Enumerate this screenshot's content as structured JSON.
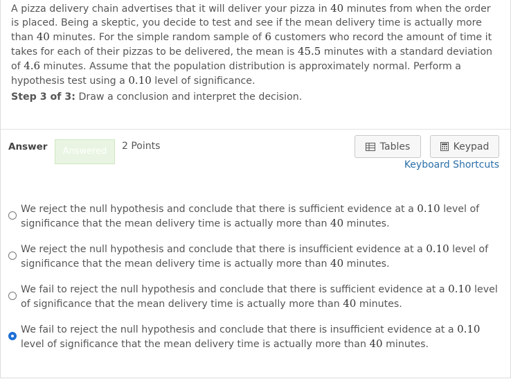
{
  "question": {
    "p1": "A pizza delivery chain advertises that it will deliver your pizza in ",
    "n1": "40",
    "p2": " minutes from when the order is placed. Being a skeptic, you decide to test and see if the mean delivery time is actually more than ",
    "n2": "40",
    "p3": " minutes. For the simple random sample of ",
    "n3": "6",
    "p4": " customers who record the amount of time it takes for each of their pizzas to be delivered, the mean is ",
    "n4": "45.5",
    "p5": " minutes with a standard deviation of ",
    "n5": "4.6",
    "p6": " minutes. Assume that the population distribution is approximately normal. Perform a hypothesis test using a ",
    "n6": "0.10",
    "p7": " level of significance."
  },
  "step": {
    "label": "Step 3 of 3:",
    "text": " Draw a conclusion and interpret the decision."
  },
  "answer": {
    "label": "Answer",
    "status": "Answered",
    "points": "2 Points"
  },
  "tools": {
    "tables_label": "Tables",
    "keypad_label": "Keypad",
    "shortcuts_label": "Keyboard Shortcuts"
  },
  "options": [
    {
      "a": "We reject the null hypothesis and conclude that there is sufficient evidence at a ",
      "n1": "0.10",
      "b": " level of significance that the mean delivery time is actually more than ",
      "n2": "40",
      "c": " minutes.",
      "selected": false
    },
    {
      "a": "We reject the null hypothesis and conclude that there is insufficient evidence at a ",
      "n1": "0.10",
      "b": " level of significance that the mean delivery time is actually more than ",
      "n2": "40",
      "c": " minutes.",
      "selected": false
    },
    {
      "a": "We fail to reject the null hypothesis and conclude that there is sufficient evidence at a ",
      "n1": "0.10",
      "b": " level of significance that the mean delivery time is actually more than ",
      "n2": "40",
      "c": " minutes.",
      "selected": false
    },
    {
      "a": "We fail to reject the null hypothesis and conclude that there is insufficient evidence at a ",
      "n1": "0.10",
      "b": " level of significance that the mean delivery time is actually more than ",
      "n2": "40",
      "c": " minutes.",
      "selected": true
    }
  ],
  "colors": {
    "link": "#2a6fa8",
    "selected_radio": "#1f6fd6",
    "answered_bg": "#e9f5e2"
  },
  "icons": {
    "tables": "table-grid-icon",
    "keypad": "calculator-icon"
  }
}
